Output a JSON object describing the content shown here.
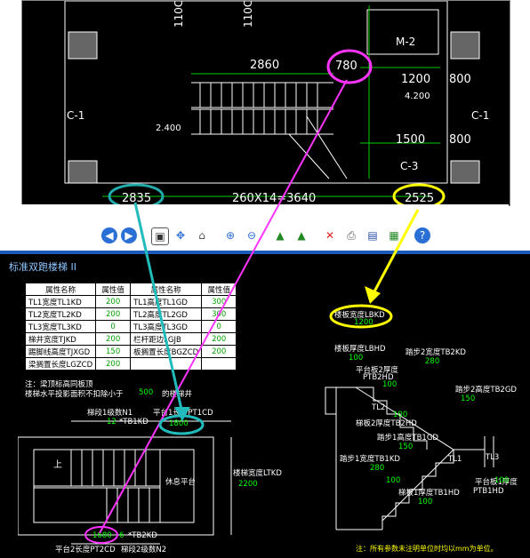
{
  "cad": {
    "dims": [
      "2860",
      "780",
      "1200",
      "800",
      "1500",
      "800",
      "2835",
      "260X14=3640",
      "2525"
    ],
    "labels": [
      "M-2",
      "4.200",
      "2.400",
      "C-1",
      "C-1",
      "C-3",
      "110C",
      "110C"
    ]
  },
  "toolbar": {
    "icons": [
      "prev-icon",
      "next-icon",
      "fit-icon",
      "pan-icon",
      "select-icon",
      "zoom-in-icon",
      "zoom-out-icon",
      "rotate-left-icon",
      "rotate-right-icon",
      "delete-icon",
      "print-icon",
      "save-icon",
      "export-image-icon",
      "help-icon"
    ]
  },
  "panel": {
    "title": "标准双跑楼梯 II",
    "table": {
      "headers": [
        "属性名称",
        "属性值",
        "属性名称",
        "属性值"
      ],
      "rows": [
        [
          "TL1宽度TL1KD",
          "200",
          "TL1高度TL1GD",
          "300"
        ],
        [
          "TL2宽度TL2KD",
          "200",
          "TL2高度TL2GD",
          "300"
        ],
        [
          "TL3宽度TL3KD",
          "0",
          "TL3高度TL3GD",
          "0"
        ],
        [
          "梯井宽度TJKD",
          "200",
          "栏杆距边LGJB",
          "200"
        ],
        [
          "踢脚线高度TJXGD",
          "150",
          "板搁置长度BGZCD",
          "200"
        ],
        [
          "梁搁置长度LGZCD",
          "200",
          "",
          ""
        ]
      ]
    },
    "notes": [
      "注：梁顶标高同板顶",
      "楼梯水平投影面积不扣除小于",
      "的楼梯井"
    ],
    "note_value": "500",
    "plan": {
      "n1_label": "梯段1级数N1",
      "n1_value": "12",
      "tb1": "*TB1KD",
      "pt1_label": "平台1长度PT1CD",
      "pt1_value": "1800",
      "up": "上",
      "rest": "休息平台",
      "width_label": "楼梯宽度LTKD",
      "width_value": "2200",
      "pt2_value": "1680",
      "n2_value": "6",
      "tb2": "*TB2KD",
      "pt2_label": "平台2长度PT2CD",
      "n2_label": "梯段2级数N2"
    },
    "section": {
      "lbkd_label": "楼板宽度LBKD",
      "lbkd_value": "1200",
      "lbhd_label": "楼板厚度LBHD",
      "lbhd_value": "100",
      "tb2kd_label": "踏步2宽度TB2KD",
      "tb2kd_value": "280",
      "pt2hd_label1": "平台板2厚度",
      "pt2hd_label2": "PTB2HD",
      "pt2hd_value": "100",
      "tb2gd_label": "踏步2高度TB2GD",
      "tb2gd_value": "150",
      "tl2": "TL2",
      "b2_value": "100",
      "b2_label": "梯板2厚度TB2HD",
      "tb1gd_label": "踏步1高度TB1GD",
      "tb1gd_value": "150",
      "tb1kd_label": "踏步1宽度TB1KD",
      "tb1kd_value": "280",
      "tl1": "TL1",
      "tl3": "TL3",
      "ptb1_label1": "平台板1厚度",
      "ptb1_label2": "PTB1HD",
      "ptb1_value": "100",
      "b1_value": "100",
      "b1_label": "梯板1厚度TB1HD",
      "b1_value2": "100"
    },
    "footnote": "注：所有参数未注明单位时均以mm为单位。"
  }
}
